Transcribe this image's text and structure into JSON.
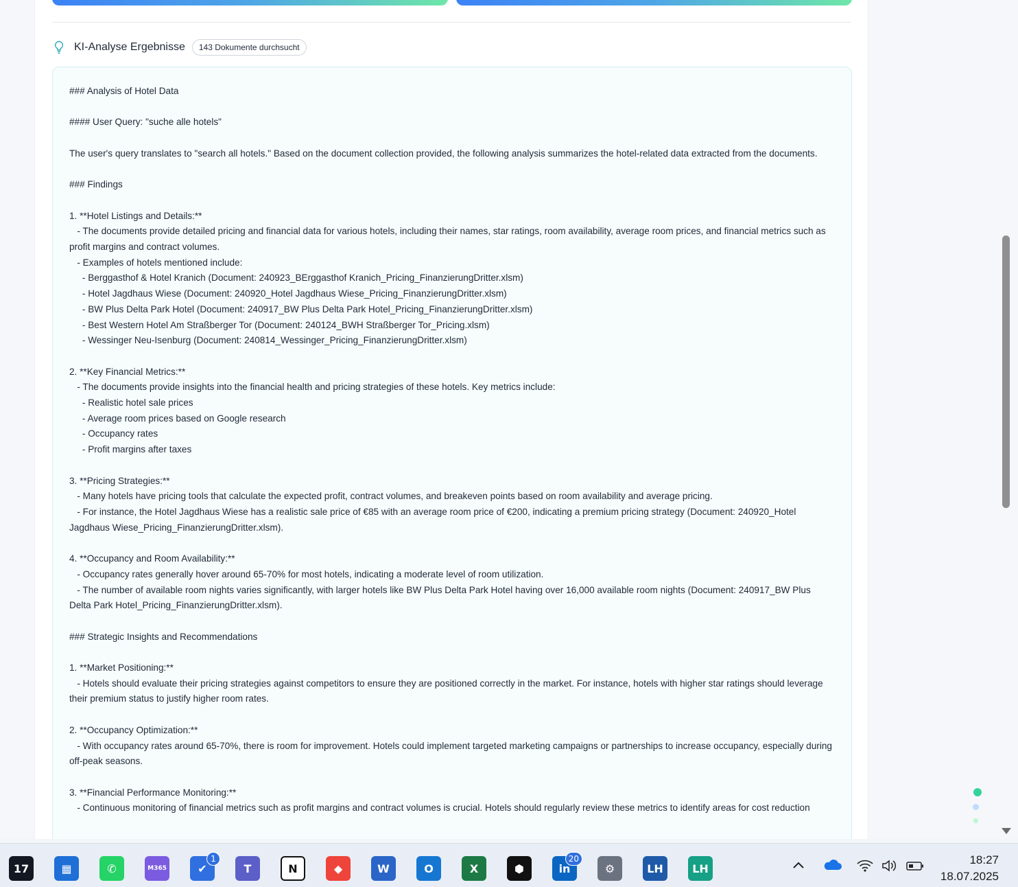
{
  "header": {
    "title": "KI-Analyse Ergebnisse",
    "badge": "143 Dokumente durchsucht"
  },
  "result": {
    "text": "### Analysis of Hotel Data\n\n#### User Query: \"suche alle hotels\"\n\nThe user's query translates to \"search all hotels.\" Based on the document collection provided, the following analysis summarizes the hotel-related data extracted from the documents.\n\n### Findings\n\n1. **Hotel Listings and Details:**\n   - The documents provide detailed pricing and financial data for various hotels, including their names, star ratings, room availability, average room prices, and financial metrics such as profit margins and contract volumes.\n   - Examples of hotels mentioned include:\n     - Berggasthof & Hotel Kranich (Document: 240923_BErggasthof Kranich_Pricing_FinanzierungDritter.xlsm)\n     - Hotel Jagdhaus Wiese (Document: 240920_Hotel Jagdhaus Wiese_Pricing_FinanzierungDritter.xlsm)\n     - BW Plus Delta Park Hotel (Document: 240917_BW Plus Delta Park Hotel_Pricing_FinanzierungDritter.xlsm)\n     - Best Western Hotel Am Straßberger Tor (Document: 240124_BWH Straßberger Tor_Pricing.xlsm)\n     - Wessinger Neu-Isenburg (Document: 240814_Wessinger_Pricing_FinanzierungDritter.xlsm)\n\n2. **Key Financial Metrics:**\n   - The documents provide insights into the financial health and pricing strategies of these hotels. Key metrics include:\n     - Realistic hotel sale prices\n     - Average room prices based on Google research\n     - Occupancy rates\n     - Profit margins after taxes\n\n3. **Pricing Strategies:**\n   - Many hotels have pricing tools that calculate the expected profit, contract volumes, and breakeven points based on room availability and average pricing.\n   - For instance, the Hotel Jagdhaus Wiese has a realistic sale price of €85 with an average room price of €200, indicating a premium pricing strategy (Document: 240920_Hotel Jagdhaus Wiese_Pricing_FinanzierungDritter.xlsm).\n\n4. **Occupancy and Room Availability:**\n   - Occupancy rates generally hover around 65-70% for most hotels, indicating a moderate level of room utilization.\n   - The number of available room nights varies significantly, with larger hotels like BW Plus Delta Park Hotel having over 16,000 available room nights (Document: 240917_BW Plus Delta Park Hotel_Pricing_FinanzierungDritter.xlsm).\n\n### Strategic Insights and Recommendations\n\n1. **Market Positioning:**\n   - Hotels should evaluate their pricing strategies against competitors to ensure they are positioned correctly in the market. For instance, hotels with higher star ratings should leverage their premium status to justify higher room rates.\n\n2. **Occupancy Optimization:**\n   - With occupancy rates around 65-70%, there is room for improvement. Hotels could implement targeted marketing campaigns or partnerships to increase occupancy, especially during off-peak seasons.\n\n3. **Financial Performance Monitoring:**\n   - Continuous monitoring of financial metrics such as profit margins and contract volumes is crucial. Hotels should regularly review these metrics to identify areas for cost reduction"
  },
  "taskbar": {
    "apps": [
      {
        "name": "tradingview-icon",
        "glyph": "17",
        "color": "#131722"
      },
      {
        "name": "microsoft-store-icon",
        "glyph": "▦",
        "color": "#1f6fd6"
      },
      {
        "name": "whatsapp-icon",
        "glyph": "✆",
        "color": "#25d366"
      },
      {
        "name": "m365-copilot-icon",
        "glyph": "M365",
        "color": "#7b5ce0"
      },
      {
        "name": "todo-icon",
        "glyph": "✔",
        "color": "#2f6fe0",
        "badge": "1"
      },
      {
        "name": "teams-icon",
        "glyph": "T",
        "color": "#5b5fc7"
      },
      {
        "name": "notion-icon",
        "glyph": "N",
        "color": "#ffffff"
      },
      {
        "name": "anydesk-icon",
        "glyph": "◆",
        "color": "#ef443b"
      },
      {
        "name": "word-icon",
        "glyph": "W",
        "color": "#2b65c8"
      },
      {
        "name": "outlook-icon",
        "glyph": "O",
        "color": "#1677d2"
      },
      {
        "name": "excel-icon",
        "glyph": "X",
        "color": "#1d7a45"
      },
      {
        "name": "cube-app-icon",
        "glyph": "⬢",
        "color": "#111111"
      },
      {
        "name": "linkedin-icon",
        "glyph": "in",
        "color": "#0a66c2",
        "badge": "20"
      },
      {
        "name": "settings-icon",
        "glyph": "⚙",
        "color": "#6b7280"
      },
      {
        "name": "linked-helper-icon",
        "glyph": "LH",
        "color": "#1e5aa8"
      },
      {
        "name": "linked-helper-2-icon",
        "glyph": "LH",
        "color": "#16a085"
      }
    ],
    "clock_time": "18:27",
    "clock_date": "18.07.2025"
  }
}
